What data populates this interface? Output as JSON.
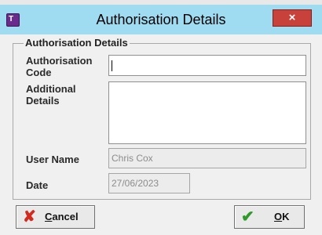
{
  "window": {
    "title": "Authorisation Details",
    "app_icon": "app-tl-icon",
    "close_glyph": "×"
  },
  "group": {
    "legend": "Authorisation Details"
  },
  "fields": {
    "auth_code": {
      "label_line1": "Authorisation",
      "label_line2": "Code",
      "value": ""
    },
    "additional": {
      "label_line1": "Additional",
      "label_line2": "Details",
      "value": ""
    },
    "user_name": {
      "label": "User Name",
      "value": "Chris Cox"
    },
    "date": {
      "label": "Date",
      "value": "27/06/2023"
    }
  },
  "buttons": {
    "cancel": {
      "label_first": "C",
      "label_rest": "ancel",
      "icon": "red-x-icon"
    },
    "ok": {
      "label_first": "O",
      "label_rest": "K",
      "icon": "green-check-icon"
    }
  },
  "colors": {
    "title_bar": "#9fdcf2",
    "close_button": "#c8413a",
    "cancel_icon": "#d22a1e",
    "ok_icon": "#2e9a2a"
  }
}
